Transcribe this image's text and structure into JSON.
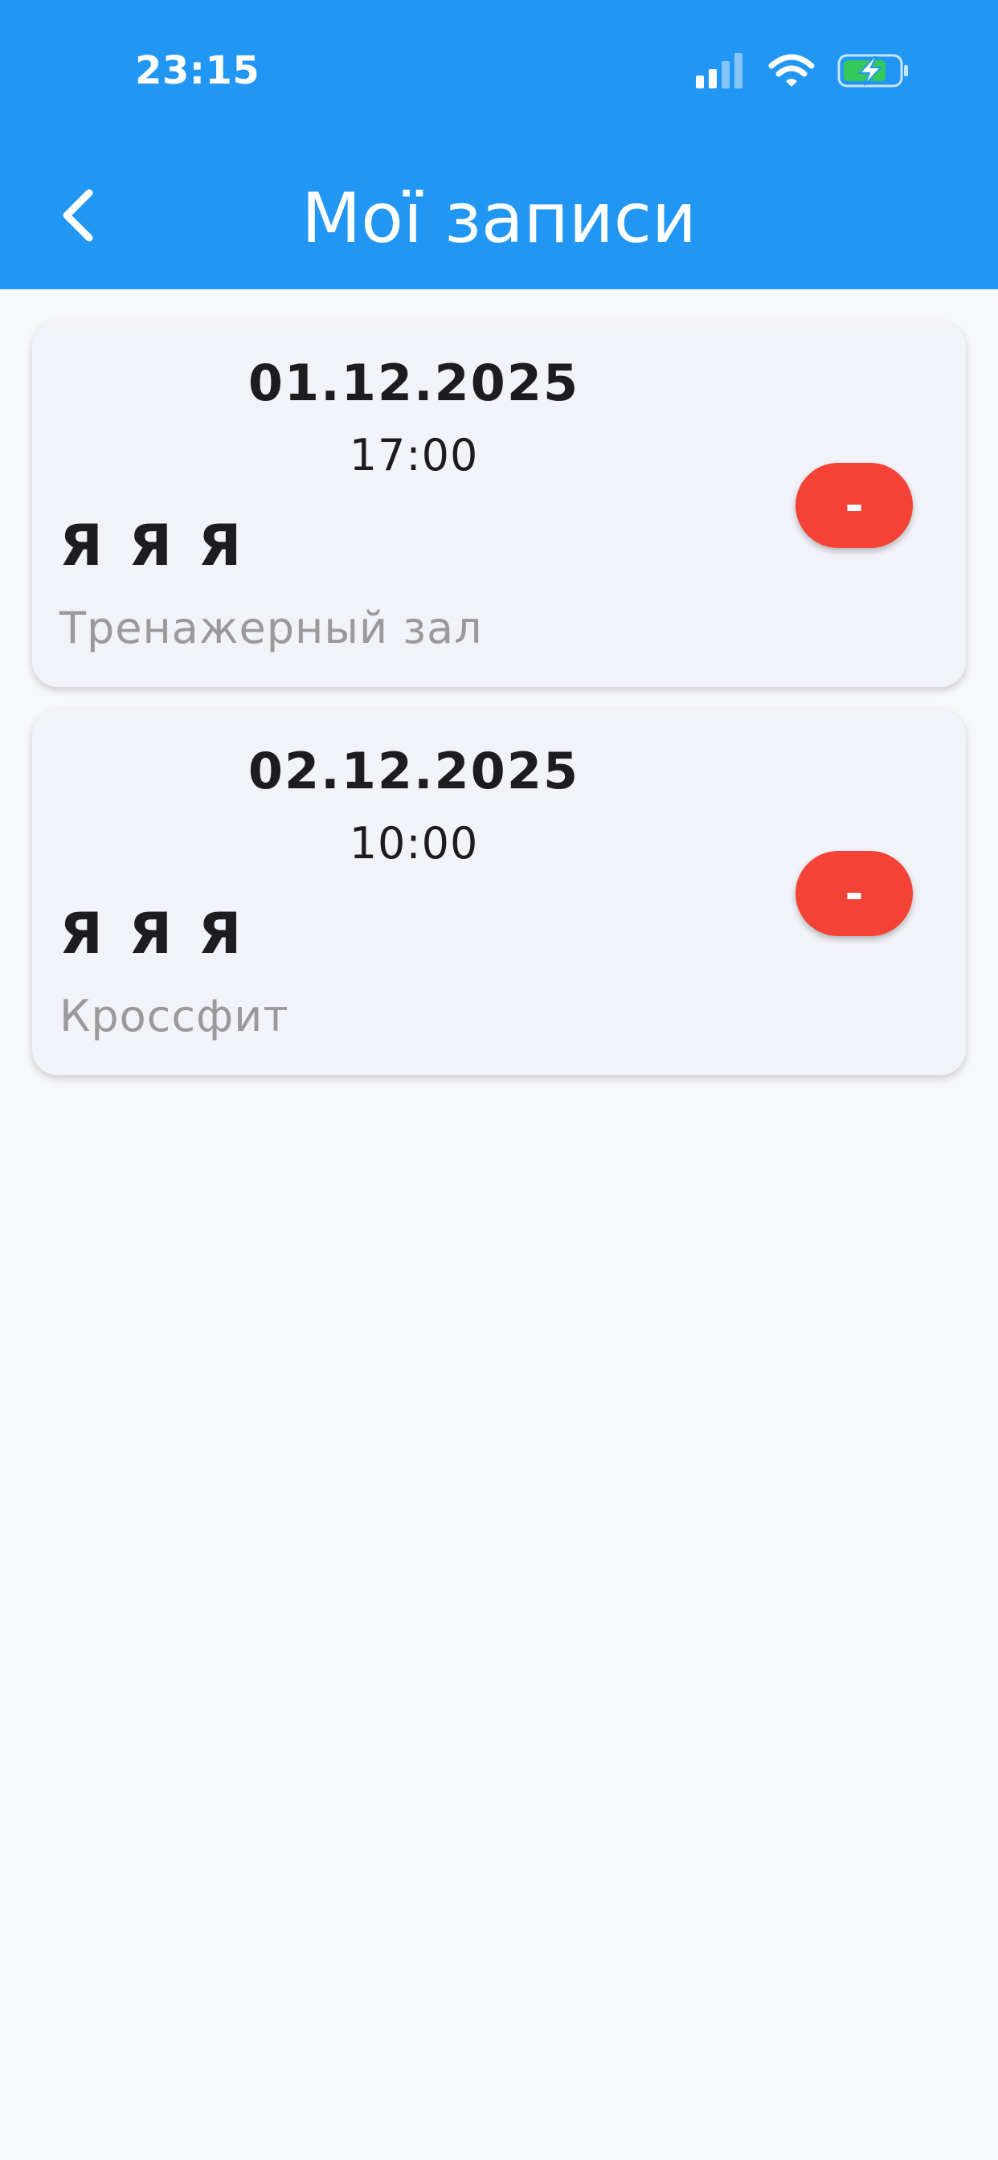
{
  "status_bar": {
    "time": "23:15",
    "icons": [
      "cellular-signal-icon",
      "wifi-icon",
      "battery-charging-icon"
    ]
  },
  "header": {
    "title": "Мої записи",
    "back_icon": "chevron-left-icon"
  },
  "bookings": [
    {
      "date": "01.12.2025",
      "time": "17:00",
      "name": "Я Я Я",
      "activity": "Тренажерный зал",
      "remove_label": "-"
    },
    {
      "date": "02.12.2025",
      "time": "10:00",
      "name": "Я Я Я",
      "activity": "Кроссфит",
      "remove_label": "-"
    }
  ],
  "colors": {
    "app_bar": "#2196f3",
    "background": "#f7f8fc",
    "card": "#f2f3f8",
    "remove_button": "#f44336",
    "secondary_text": "#9a9a9d",
    "battery_fill": "#34c759"
  }
}
